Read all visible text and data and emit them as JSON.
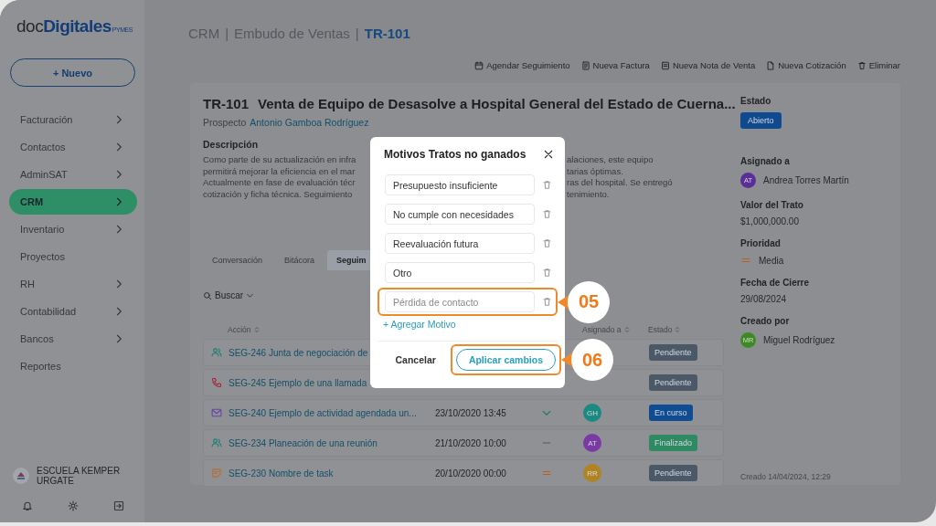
{
  "sidebar": {
    "logo": {
      "prefix": "doc",
      "main": "Digitales",
      "suffix": "PYMES"
    },
    "new_button": "+ Nuevo",
    "items": [
      {
        "label": "Facturación",
        "has_submenu": true,
        "selected": false
      },
      {
        "label": "Contactos",
        "has_submenu": true,
        "selected": false
      },
      {
        "label": "AdminSAT",
        "has_submenu": true,
        "selected": false
      },
      {
        "label": "CRM",
        "has_submenu": true,
        "selected": true
      },
      {
        "label": "Inventario",
        "has_submenu": true,
        "selected": false
      },
      {
        "label": "Proyectos",
        "has_submenu": false,
        "selected": false
      },
      {
        "label": "RH",
        "has_submenu": true,
        "selected": false
      },
      {
        "label": "Contabilidad",
        "has_submenu": true,
        "selected": false
      },
      {
        "label": "Bancos",
        "has_submenu": true,
        "selected": false
      },
      {
        "label": "Reportes",
        "has_submenu": false,
        "selected": false
      }
    ],
    "company": "ESCUELA KEMPER URGATE"
  },
  "breadcrumb": [
    {
      "kind": "link",
      "label": "CRM"
    },
    {
      "kind": "separator",
      "label": "|"
    },
    {
      "kind": "link",
      "label": "Embudo de Ventas"
    },
    {
      "kind": "separator",
      "label": "|"
    },
    {
      "kind": "current",
      "label": "TR-101"
    }
  ],
  "actions": [
    {
      "kind": "calendar",
      "label": "Agendar Seguimiento"
    },
    {
      "kind": "invoice",
      "label": "Nueva Factura"
    },
    {
      "kind": "receipt",
      "label": "Nueva Nota de Venta"
    },
    {
      "kind": "document",
      "label": "Nueva Cotización"
    },
    {
      "kind": "trash",
      "label": "Eliminar"
    }
  ],
  "deal": {
    "code": "TR-101",
    "title": "Venta de Equipo de Desasolve a Hospital General del Estado de Cuerna...",
    "prospect_label": "Prospecto",
    "prospect": "Antonio Gamboa Rodríguez",
    "description_label": "Descripción",
    "description_lines": [
      {
        "left": "Como parte de su actualización en infra",
        "right": "alaciones, este equipo"
      },
      {
        "left": "permitirá mejorar la eficiencia en el mar",
        "right": "tarias óptimas."
      },
      {
        "left": "Actualmente en fase de evaluación técr",
        "right": "ras del hospital. Se entregó"
      },
      {
        "left": "cotización y ficha técnica. Seguimiento",
        "right": "tenimiento."
      }
    ]
  },
  "tabs": [
    {
      "label": "Conversación",
      "selected": false
    },
    {
      "label": "Bitácora",
      "selected": false
    },
    {
      "label": "Seguim",
      "selected": true
    }
  ],
  "search": {
    "label": "Buscar"
  },
  "table": {
    "columns": {
      "action": "Acción",
      "assignee": "Asignado a",
      "status": "Estado"
    },
    "rows": [
      {
        "kind": "meeting",
        "action": "SEG-246 Junta de negociación de",
        "status": {
          "label": "Pendiente",
          "color": "#4a5868"
        }
      },
      {
        "kind": "call",
        "action": "SEG-245 Ejemplo de una llamada",
        "status": {
          "label": "Pendiente",
          "color": "#4a5868"
        }
      },
      {
        "kind": "email",
        "action": "SEG-240 Ejemplo de actividad agendada un...",
        "date": "23/10/2020 13:45",
        "priority": {
          "kind": "low"
        },
        "assignee": {
          "initials": "GH",
          "color": "#1a8a80"
        },
        "status": {
          "label": "En curso",
          "color": "#0f4c92"
        }
      },
      {
        "kind": "meeting",
        "action": "SEG-234 Planeación de una reunión",
        "date": "21/10/2020 10:00",
        "priority": {
          "kind": "none"
        },
        "assignee": {
          "initials": "AT",
          "color": "#7a3aa6"
        },
        "status": {
          "label": "Finalizado",
          "color": "#2d8a62"
        }
      },
      {
        "kind": "task",
        "action": "SEG-230 Nombre de task",
        "date": "20/10/2020 00:00",
        "priority": {
          "kind": "medium"
        },
        "assignee": {
          "initials": "RR",
          "color": "#b08424"
        },
        "status": {
          "label": "Pendiente",
          "color": "#4a5868"
        }
      }
    ]
  },
  "details": {
    "status_label": "Estado",
    "status": {
      "label": "Abierto",
      "color": "#104a8e"
    },
    "assigned_label": "Asignado a",
    "assignee": {
      "initials": "AT",
      "name": "Andrea Torres Martín",
      "color": "#5b2d99"
    },
    "value_label": "Valor del Trato",
    "value": "$1,000,000.00",
    "priority_label": "Prioridad",
    "priority": {
      "kind": "medium",
      "label": "Media"
    },
    "close_label": "Fecha de Cierre",
    "close_date": "29/08/2024",
    "created_label": "Creado por",
    "creator": {
      "initials": "MR",
      "name": "Miguel Rodríguez",
      "color": "#3d8a22"
    },
    "created_at": "Creado 14/04/2024, 12:29"
  },
  "modal": {
    "title": "Motivos Tratos no ganados",
    "reasons": [
      {
        "value": "Presupuesto insuficiente",
        "highlighted": false
      },
      {
        "value": "No cumple con necesidades",
        "highlighted": false
      },
      {
        "value": "Reevaluación futura",
        "highlighted": false
      },
      {
        "value": "Otro",
        "highlighted": false
      },
      {
        "placeholder": "Pérdida de contacto",
        "highlighted": true,
        "callout": "05"
      }
    ],
    "add_link": "+ Agregar Motivo",
    "cancel": "Cancelar",
    "apply": {
      "label": "Aplicar cambios",
      "highlighted": true,
      "callout": "06"
    }
  }
}
